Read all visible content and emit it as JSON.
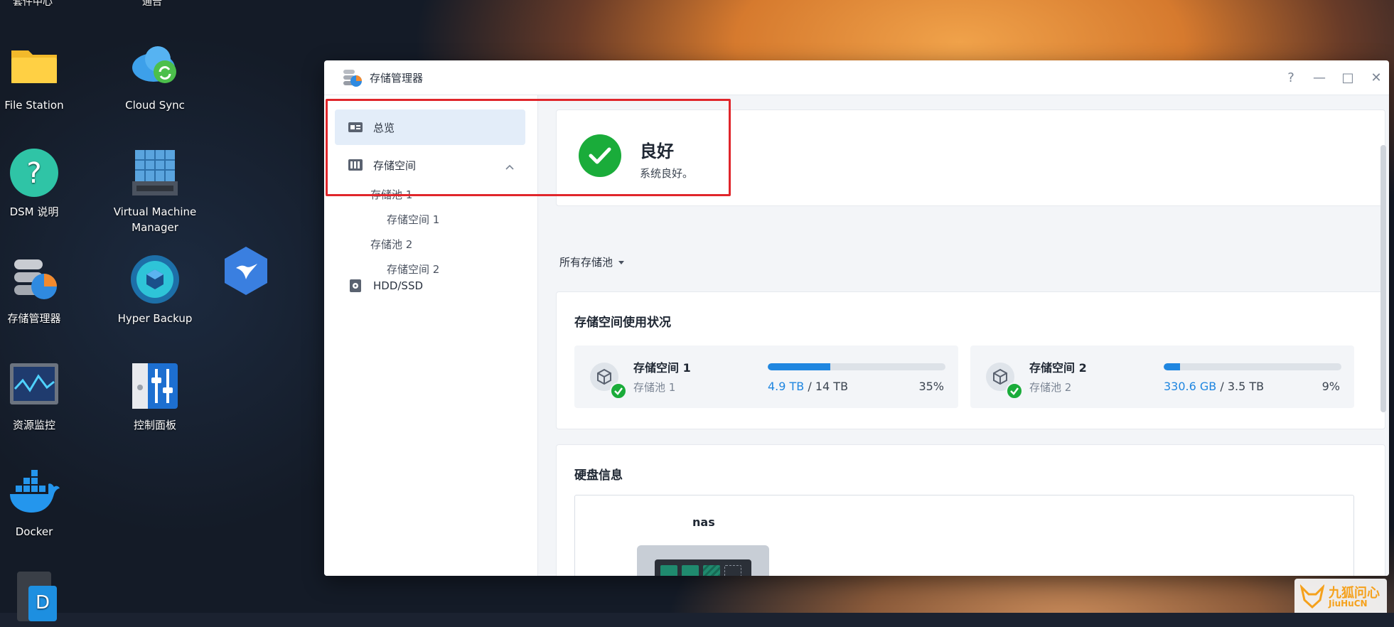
{
  "desktop": {
    "top_cut_labels": [
      "套件中心",
      "通告"
    ],
    "icons": [
      {
        "label": "File Station",
        "icon": "folder-icon"
      },
      {
        "label": "Cloud Sync",
        "icon": "cloud-sync-icon"
      },
      {
        "label": "DSM 说明",
        "icon": "help-icon"
      },
      {
        "label": "Virtual Machine Manager",
        "icon": "server-rack-icon"
      },
      {
        "label": "存储管理器",
        "icon": "storage-manager-icon"
      },
      {
        "label": "Hyper Backup",
        "icon": "hyper-backup-icon"
      },
      {
        "label": "",
        "icon": "bird-app-icon"
      },
      {
        "label": "资源监控",
        "icon": "resource-monitor-icon"
      },
      {
        "label": "控制面板",
        "icon": "control-panel-icon"
      },
      {
        "label": "Docker",
        "icon": "docker-icon"
      }
    ]
  },
  "window": {
    "title": "存储管理器",
    "controls": {
      "help": "?",
      "minimize": "—",
      "maximize": "□",
      "close": "✕"
    }
  },
  "sidebar": {
    "overview": "总览",
    "storage": "存储空间",
    "pool1": "存储池 1",
    "vol1": "存储空间 1",
    "pool2": "存储池 2",
    "vol2": "存储空间 2",
    "hdd": "HDD/SSD"
  },
  "status": {
    "title": "良好",
    "subtitle": "系统良好。"
  },
  "filter": {
    "label": "所有存储池"
  },
  "usage": {
    "title": "存储空间使用状况",
    "volumes": [
      {
        "name": "存储空间 1",
        "pool": "存储池 1",
        "used": "4.9 TB",
        "sep": " / ",
        "total": "14 TB",
        "percent": "35%",
        "fraction": 0.35
      },
      {
        "name": "存储空间 2",
        "pool": "存储池 2",
        "used": "330.6 GB",
        "sep": " / ",
        "total": "3.5 TB",
        "percent": "9%",
        "fraction": 0.09
      }
    ]
  },
  "hdd": {
    "title": "硬盘信息",
    "device": "nas",
    "bays": [
      "1",
      "2",
      "3",
      "4"
    ]
  },
  "watermark": {
    "line1": "九狐问心",
    "line2": "JiuHuCN"
  },
  "colors": {
    "accent": "#1f86e0",
    "ok": "#1aac3a",
    "highlight": "#e0262b"
  }
}
